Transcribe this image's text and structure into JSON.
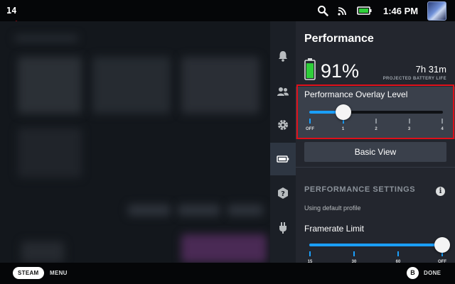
{
  "topbar": {
    "fps_counter": "14",
    "clock": "1:46 PM",
    "icons": [
      "search-icon",
      "cast-icon",
      "battery-icon",
      "avatar"
    ]
  },
  "sidebar": {
    "items": [
      {
        "icon": "bell-icon",
        "active": false
      },
      {
        "icon": "friends-icon",
        "active": false
      },
      {
        "icon": "gear-icon",
        "active": false
      },
      {
        "icon": "battery-icon",
        "active": true
      },
      {
        "icon": "help-icon",
        "active": false
      },
      {
        "icon": "power-plug-icon",
        "active": false
      }
    ]
  },
  "panel": {
    "title": "Performance",
    "battery": {
      "percent": "91%",
      "percent_value": 91,
      "time": "7h 31m",
      "time_label": "PROJECTED BATTERY LIFE"
    },
    "overlay": {
      "label": "Performance Overlay Level",
      "ticks": [
        "OFF",
        "1",
        "2",
        "3",
        "4"
      ],
      "selected_index": 1
    },
    "basic_view_label": "Basic View",
    "settings_header": "PERFORMANCE SETTINGS",
    "profile_note": "Using default profile",
    "framerate": {
      "label": "Framerate Limit",
      "ticks": [
        "15",
        "30",
        "60",
        "OFF"
      ],
      "selected_index": 3
    }
  },
  "bottombar": {
    "steam_label": "STEAM",
    "menu_label": "MENU",
    "b_label": "B",
    "done_label": "DONE"
  },
  "colors": {
    "accent": "#1a9fff",
    "highlight": "#e0101a",
    "battery_green": "#2fcf3a"
  }
}
